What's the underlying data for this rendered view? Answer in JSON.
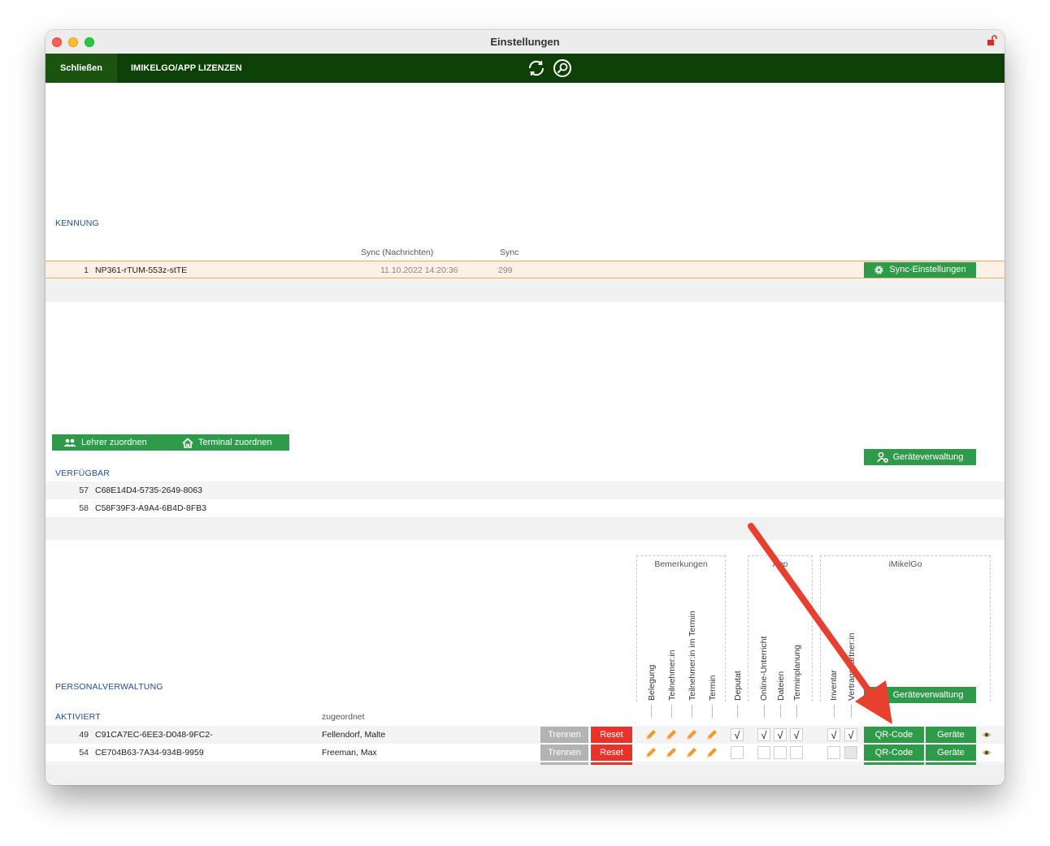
{
  "window": {
    "title": "Einstellungen"
  },
  "toolbar": {
    "close_label": "Schließen",
    "licenses_label": "IMIKELGO/APP LIZENZEN"
  },
  "kennung": {
    "section_label": "KENNUNG",
    "columns": {
      "sync_messages": "Sync (Nachrichten)",
      "sync": "Sync"
    },
    "rows": [
      {
        "num": "1",
        "id": "NP361-rTUM-553z-stTE",
        "sync_messages": "11.10.2022 14:20:36",
        "sync": "299"
      }
    ],
    "sync_settings_label": "Sync-Einstellungen"
  },
  "available": {
    "assign_teacher_label": "Lehrer zuordnen",
    "assign_terminal_label": "Terminal zuordnen",
    "device_mgmt_label": "Geräteverwaltung",
    "section_label": "VERFÜGBAR",
    "rows": [
      {
        "num": "57",
        "id": "C68E14D4-5735-2649-8063"
      },
      {
        "num": "58",
        "id": "C58F39F3-A9A4-6B4D-8FB3"
      }
    ]
  },
  "personnel": {
    "section_label": "PERSONALVERWALTUNG",
    "active_label": "AKTIVIERT",
    "assigned_header": "zugeordnet",
    "device_mgmt_label": "Geräteverwaltung",
    "groups": {
      "remarks": "Bemerkungen",
      "app": "App",
      "imikelgo": "iMikelGo"
    },
    "column_headers": {
      "belegung": "Belegung",
      "teilnehmer": "Teilnehmer:in",
      "teilnehmer_termin": "Teilnehmer:in im Termin",
      "termin": "Termin",
      "deputat": "Deputat",
      "online": "Online-Unterricht",
      "dateien": "Dateien",
      "terminplanung": "Terminplanung",
      "inventar": "Inventar",
      "vertragspartner": "Vertragspartner:in"
    },
    "buttons": {
      "separate": "Trennen",
      "reset": "Reset",
      "qr": "QR-Code",
      "devices": "Geräte"
    },
    "rows": [
      {
        "num": "49",
        "id": "C91CA7EC-6EE3-D048-9FC2-",
        "assigned": "Fellendorf, Malte",
        "check_mark": "√"
      },
      {
        "num": "54",
        "id": "CE704B63-7A34-934B-9959",
        "assigned": "Freeman, Max",
        "check_mark": ""
      }
    ]
  },
  "colors": {
    "toolbar": "#0d4006",
    "green_button": "#2f9a49",
    "red_button": "#e8322a",
    "label_blue": "#1f4e8c",
    "arrow": "#e8402e"
  }
}
